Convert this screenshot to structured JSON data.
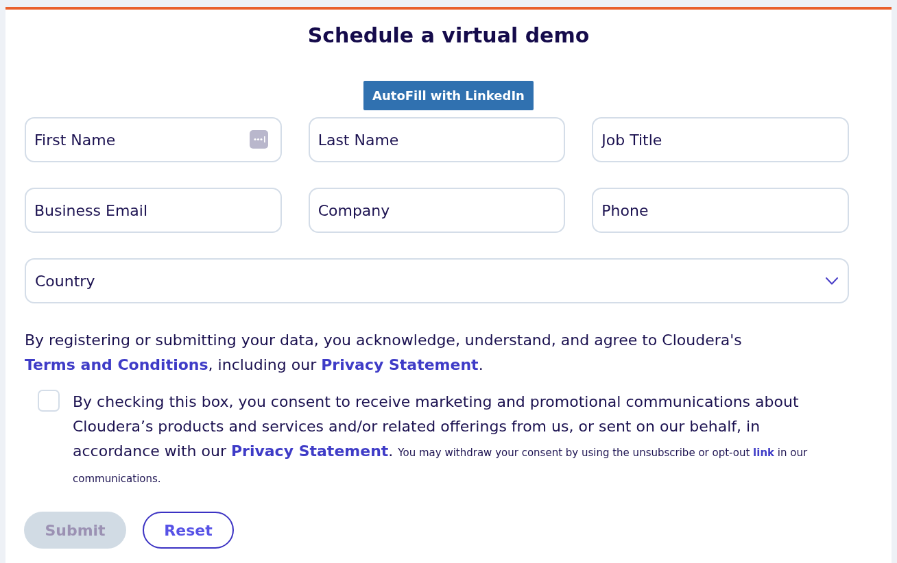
{
  "form": {
    "title": "Schedule a virtual demo",
    "autofill_button": {
      "label": "AutoFill with LinkedIn"
    },
    "fields": [
      {
        "kind": "text",
        "placeholder": "First Name",
        "autofill_icon": true
      },
      {
        "kind": "text",
        "placeholder": "Last Name"
      },
      {
        "kind": "text",
        "placeholder": "Job Title"
      },
      {
        "kind": "text",
        "placeholder": "Business Email"
      },
      {
        "kind": "text",
        "placeholder": "Company"
      },
      {
        "kind": "text",
        "placeholder": "Phone"
      },
      {
        "kind": "select",
        "placeholder": "Country"
      }
    ],
    "agreement": [
      {
        "kind": "text",
        "text": "By registering or submitting your data, you acknowledge, understand, and agree to Cloudera's "
      },
      {
        "kind": "link",
        "text": "Terms and Conditions"
      },
      {
        "kind": "text",
        "text": ", including our "
      },
      {
        "kind": "link",
        "text": "Privacy Statement"
      },
      {
        "kind": "text",
        "text": "."
      }
    ],
    "consent": {
      "checked": false,
      "segments": [
        {
          "kind": "text",
          "text": "By checking this box, you consent to receive marketing and promotional communications about Cloudera’s products and services and/or related offerings from us, or sent on our behalf, in accordance with our "
        },
        {
          "kind": "link",
          "text": "Privacy Statement"
        },
        {
          "kind": "text",
          "text": ". "
        },
        {
          "kind": "note",
          "text": "You may withdraw your consent by using the unsubscribe or opt-out "
        },
        {
          "kind": "note_link",
          "text": "link"
        },
        {
          "kind": "note",
          "text": " in our communications."
        }
      ]
    },
    "buttons": [
      {
        "label": "Submit",
        "kind": "primary",
        "disabled": true
      },
      {
        "label": "Reset",
        "kind": "secondary",
        "disabled": false
      }
    ]
  }
}
